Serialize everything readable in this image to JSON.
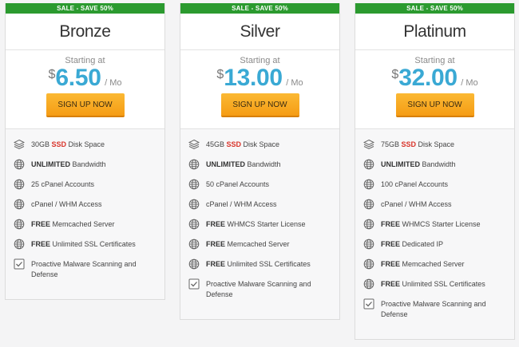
{
  "plans": [
    {
      "sale": "SALE - SAVE 50%",
      "name": "Bronze",
      "starting": "Starting at",
      "currency": "$",
      "amount": "6.50",
      "per": "/ Mo",
      "button": "SIGN UP NOW",
      "features": [
        {
          "icon": "layers-icon",
          "pre": "30GB ",
          "highlight": "SSD",
          "text": " Disk Space"
        },
        {
          "icon": "globe-icon",
          "bold": "UNLIMITED",
          "text": " Bandwidth"
        },
        {
          "icon": "globe-icon",
          "text": "25 cPanel Accounts"
        },
        {
          "icon": "globe-icon",
          "text": "cPanel / WHM Access"
        },
        {
          "icon": "globe-icon",
          "bold": "FREE",
          "text": " Memcached Server"
        },
        {
          "icon": "globe-icon",
          "bold": "FREE",
          "text": " Unlimited SSL Certificates"
        },
        {
          "icon": "checkbox-icon",
          "text": "Proactive Malware Scanning and Defense"
        }
      ]
    },
    {
      "sale": "SALE - SAVE 50%",
      "name": "Silver",
      "starting": "Starting at",
      "currency": "$",
      "amount": "13.00",
      "per": "/ Mo",
      "button": "SIGN UP NOW",
      "features": [
        {
          "icon": "layers-icon",
          "pre": "45GB ",
          "highlight": "SSD",
          "text": " Disk Space"
        },
        {
          "icon": "globe-icon",
          "bold": "UNLIMITED",
          "text": " Bandwidth"
        },
        {
          "icon": "globe-icon",
          "text": "50 cPanel Accounts"
        },
        {
          "icon": "globe-icon",
          "text": "cPanel / WHM Access"
        },
        {
          "icon": "globe-icon",
          "bold": "FREE",
          "text": " WHMCS Starter License"
        },
        {
          "icon": "globe-icon",
          "bold": "FREE",
          "text": " Memcached Server"
        },
        {
          "icon": "globe-icon",
          "bold": "FREE",
          "text": " Unlimited SSL Certificates"
        },
        {
          "icon": "checkbox-icon",
          "text": "Proactive Malware Scanning and Defense"
        }
      ]
    },
    {
      "sale": "SALE - SAVE 50%",
      "name": "Platinum",
      "starting": "Starting at",
      "currency": "$",
      "amount": "32.00",
      "per": "/ Mo",
      "button": "SIGN UP NOW",
      "features": [
        {
          "icon": "layers-icon",
          "pre": "75GB ",
          "highlight": "SSD",
          "text": " Disk Space"
        },
        {
          "icon": "globe-icon",
          "bold": "UNLIMITED",
          "text": " Bandwidth"
        },
        {
          "icon": "globe-icon",
          "text": "100 cPanel Accounts"
        },
        {
          "icon": "globe-icon",
          "text": "cPanel / WHM Access"
        },
        {
          "icon": "globe-icon",
          "bold": "FREE",
          "text": " WHMCS Starter License"
        },
        {
          "icon": "globe-icon",
          "bold": "FREE",
          "text": " Dedicated IP"
        },
        {
          "icon": "globe-icon",
          "bold": "FREE",
          "text": " Memcached Server"
        },
        {
          "icon": "globe-icon",
          "bold": "FREE",
          "text": " Unlimited SSL Certificates"
        },
        {
          "icon": "checkbox-icon",
          "text": "Proactive Malware Scanning and Defense"
        }
      ]
    }
  ],
  "colors": {
    "sale_banner": "#2b9a2f",
    "price": "#3aa9d4",
    "button": "#f7a823",
    "ssd_highlight": "#d9342b"
  }
}
